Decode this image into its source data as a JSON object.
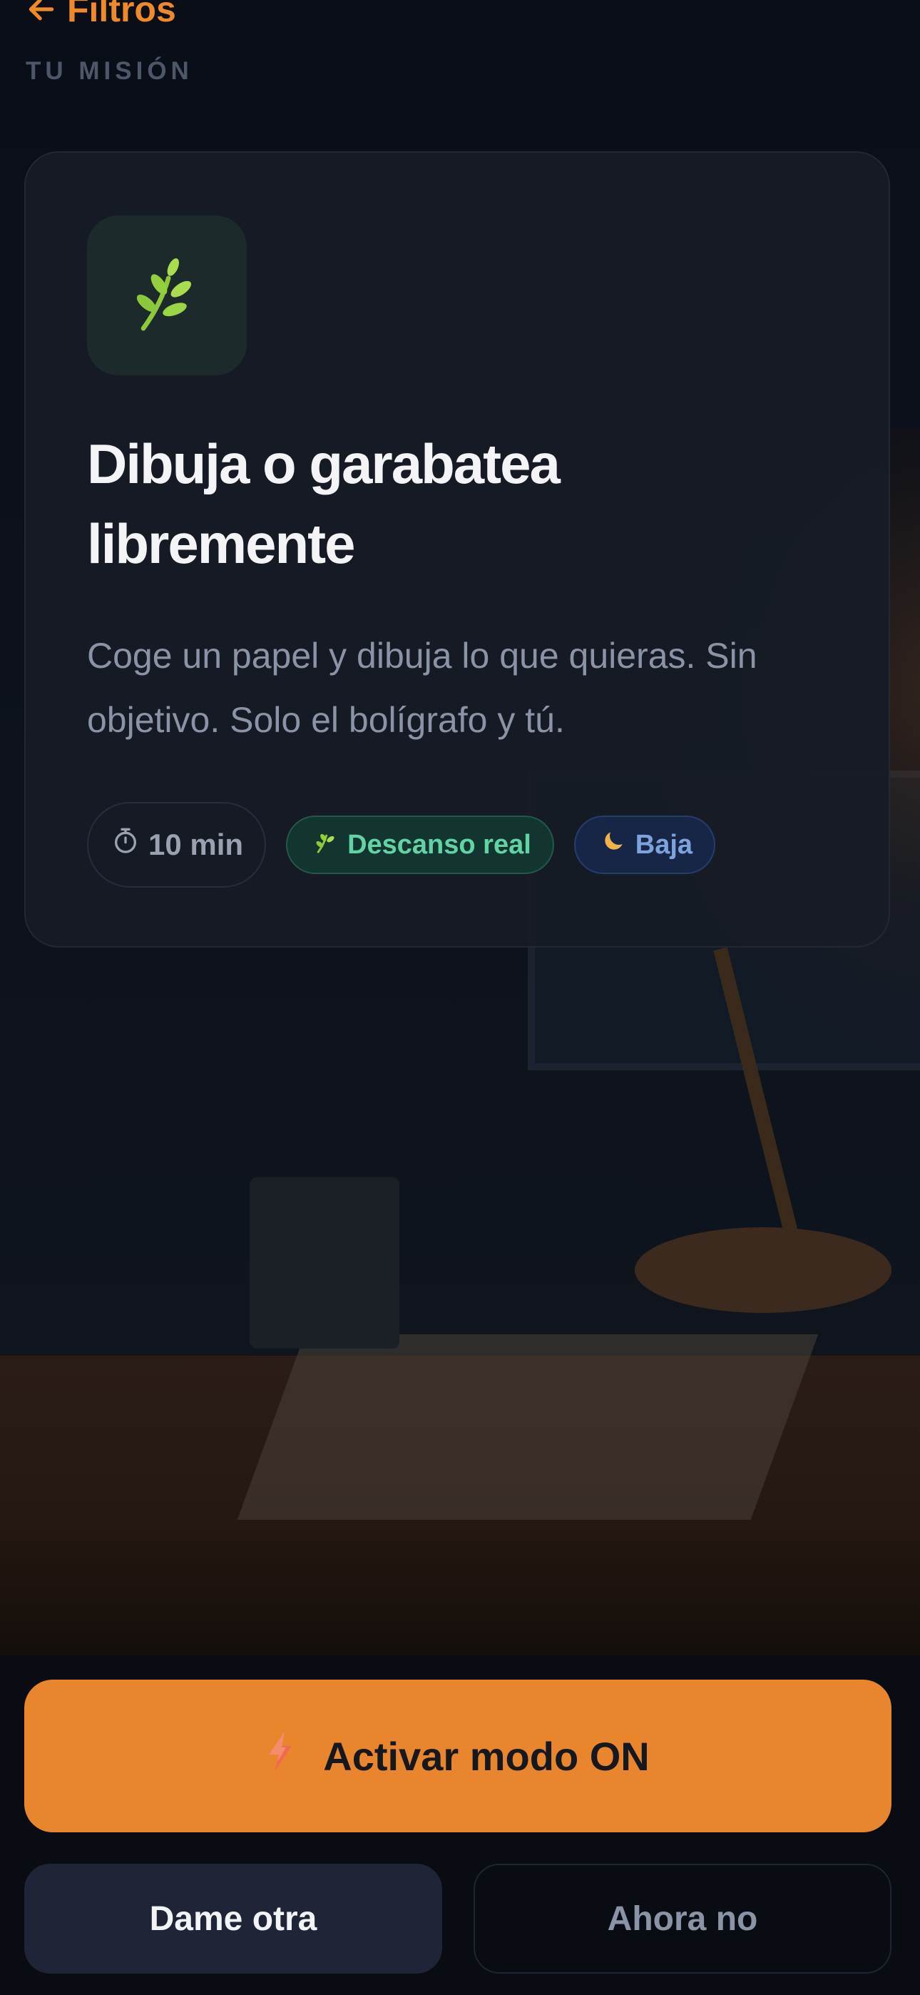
{
  "header": {
    "back_label": "Filtros",
    "section_label": "TU MISIÓN"
  },
  "mission": {
    "icon": "leaf-sprig-icon",
    "title": "Dibuja o garabatea libremente",
    "description": "Coge un papel y dibuja lo que quieras. Sin objetivo. Solo el bolígrafo y tú.",
    "tags": {
      "duration": {
        "icon": "stopwatch-icon",
        "label": "10 min"
      },
      "category": {
        "icon": "leaf-icon",
        "label": "Descanso real"
      },
      "energy": {
        "icon": "moon-icon",
        "label": "Baja"
      }
    }
  },
  "actions": {
    "primary": {
      "icon": "lightning-icon",
      "label": "Activar modo ON"
    },
    "secondary": {
      "label": "Dame otra"
    },
    "tertiary": {
      "label": "Ahora no"
    }
  },
  "colors": {
    "background": "#0b0f18",
    "card": "#161b25",
    "accent": "#e9852c",
    "tag_green": "#63d3a6",
    "tag_blue": "#7ea2dd"
  }
}
